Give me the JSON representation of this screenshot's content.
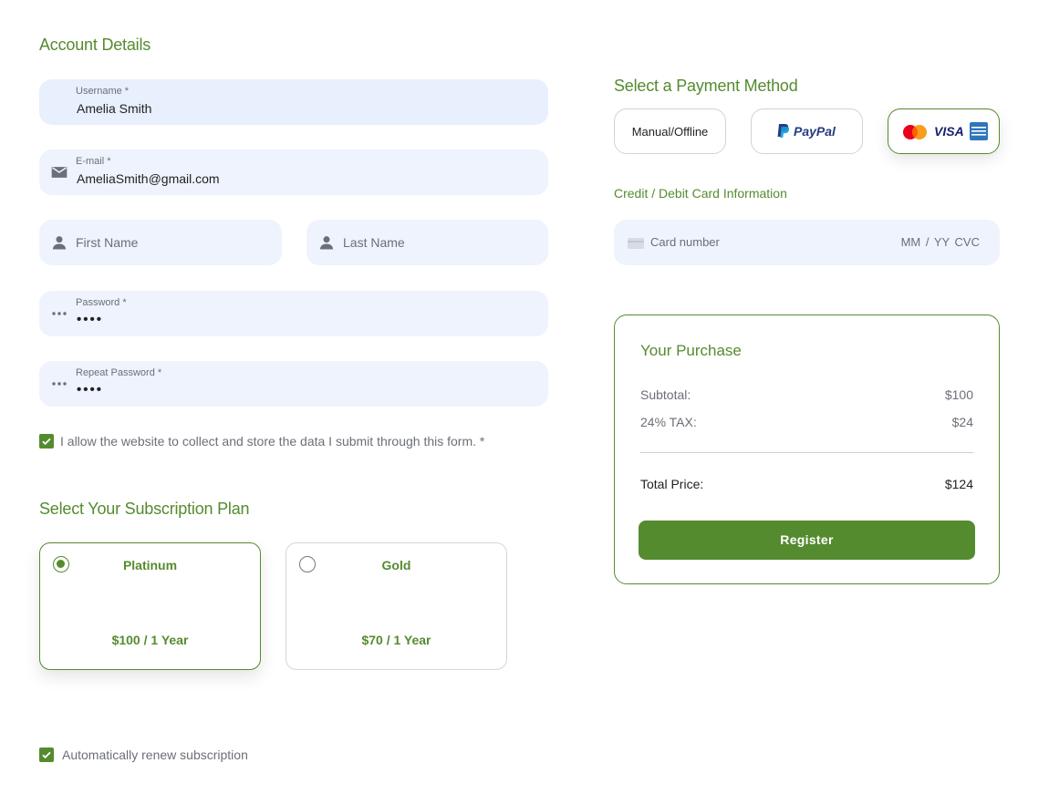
{
  "account": {
    "title": "Account Details",
    "username": {
      "label": "Username *",
      "value": "Amelia Smith"
    },
    "email": {
      "label": "E-mail *",
      "value": "AmeliaSmith@gmail.com"
    },
    "first_name": {
      "placeholder": "First Name"
    },
    "last_name": {
      "placeholder": "Last Name"
    },
    "password": {
      "label": "Password *",
      "value": "••••"
    },
    "repeat_password": {
      "label": "Repeat Password *",
      "value": "••••"
    },
    "consent": {
      "label": "I allow the website to collect and store the data I submit through this form. *",
      "checked": true
    }
  },
  "subscription": {
    "title": "Select Your Subscription Plan",
    "plans": [
      {
        "name": "Platinum",
        "price": "$100 / 1 Year",
        "selected": true
      },
      {
        "name": "Gold",
        "price": "$70 / 1 Year",
        "selected": false
      }
    ],
    "auto_renew": {
      "label": "Automatically renew subscription",
      "checked": true
    }
  },
  "payment": {
    "title": "Select a Payment Method",
    "methods": [
      {
        "label": "Manual/Offline",
        "selected": false
      },
      {
        "label": "PayPal",
        "selected": false
      },
      {
        "label": "VISA",
        "selected": true
      }
    ],
    "card_title": "Credit / Debit Card Information",
    "card_number_placeholder": "Card number",
    "card_expiry_cvc_placeholder": "MM / YY  CVC"
  },
  "purchase": {
    "title": "Your Purchase",
    "subtotal_label": "Subtotal:",
    "subtotal_value": "$100",
    "tax_label": "24% TAX:",
    "tax_value": "$24",
    "total_label": "Total Price:",
    "total_value": "$124",
    "register_label": "Register"
  },
  "colors": {
    "accent": "#558b2f",
    "field_bg": "#eef3fd"
  }
}
